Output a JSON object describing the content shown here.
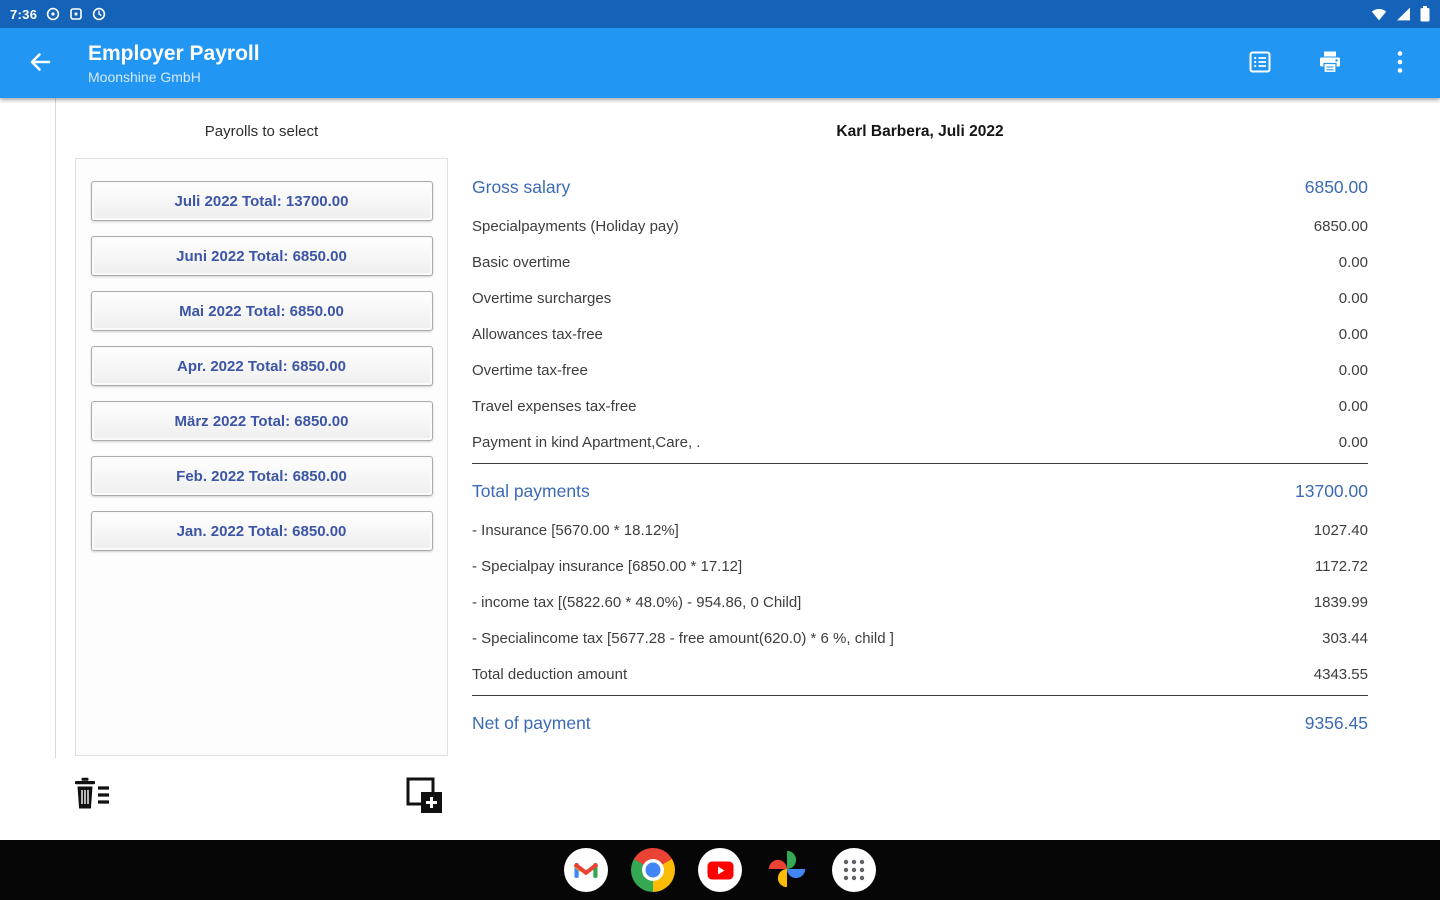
{
  "status_bar": {
    "time": "7:36"
  },
  "app_bar": {
    "title": "Employer Payroll",
    "subtitle": "Moonshine GmbH",
    "actions": [
      "Payroll report",
      "Print",
      "More options"
    ]
  },
  "headers": {
    "left": "Payrolls to select",
    "right": "Karl Barbera, Juli 2022"
  },
  "payroll_list": [
    "Juli 2022 Total: 13700.00",
    "Juni 2022 Total: 6850.00",
    "Mai 2022 Total: 6850.00",
    "Apr. 2022 Total: 6850.00",
    "März 2022 Total: 6850.00",
    "Feb. 2022 Total: 6850.00",
    "Jan. 2022 Total: 6850.00"
  ],
  "details": {
    "rows": [
      {
        "label": "Gross salary",
        "value": "6850.00",
        "accent": true
      },
      {
        "label": "Specialpayments (Holiday pay)",
        "value": "6850.00"
      },
      {
        "label": "Basic overtime",
        "value": "0.00"
      },
      {
        "label": "Overtime surcharges",
        "value": "0.00"
      },
      {
        "label": "Allowances tax-free",
        "value": "0.00"
      },
      {
        "label": "Overtime tax-free",
        "value": "0.00"
      },
      {
        "label": "Travel expenses tax-free",
        "value": "0.00"
      },
      {
        "label": "Payment in kind Apartment,Care, .",
        "value": "0.00",
        "rule_after": true
      },
      {
        "label": "Total payments",
        "value": "13700.00",
        "accent": true
      },
      {
        "label": "- Insurance [5670.00 * 18.12%]",
        "value": "1027.40"
      },
      {
        "label": "- Specialpay insurance [6850.00 * 17.12]",
        "value": "1172.72"
      },
      {
        "label": "- income tax [(5822.60 * 48.0%) - 954.86, 0 Child]",
        "value": "1839.99"
      },
      {
        "label": "- Specialincome tax [5677.28 - free amount(620.0) * 6 %, child ]",
        "value": "303.44"
      },
      {
        "label": "Total deduction amount",
        "value": "4343.55",
        "rule_after": true
      },
      {
        "label": "Net of payment",
        "value": "9356.45",
        "accent": true
      }
    ]
  },
  "toolbar": {
    "icons": [
      "delete-payroll-icon",
      "add-payroll-icon"
    ]
  },
  "dock": {
    "items": [
      "Gmail",
      "Chrome",
      "YouTube",
      "Photos",
      "All apps"
    ]
  },
  "colors": {
    "status_bar": "#1463b8",
    "app_bar": "#2196f3",
    "accent_row": "#3c6ab5",
    "accent_button": "#3c55a5",
    "rule": "#3b3b3b"
  }
}
